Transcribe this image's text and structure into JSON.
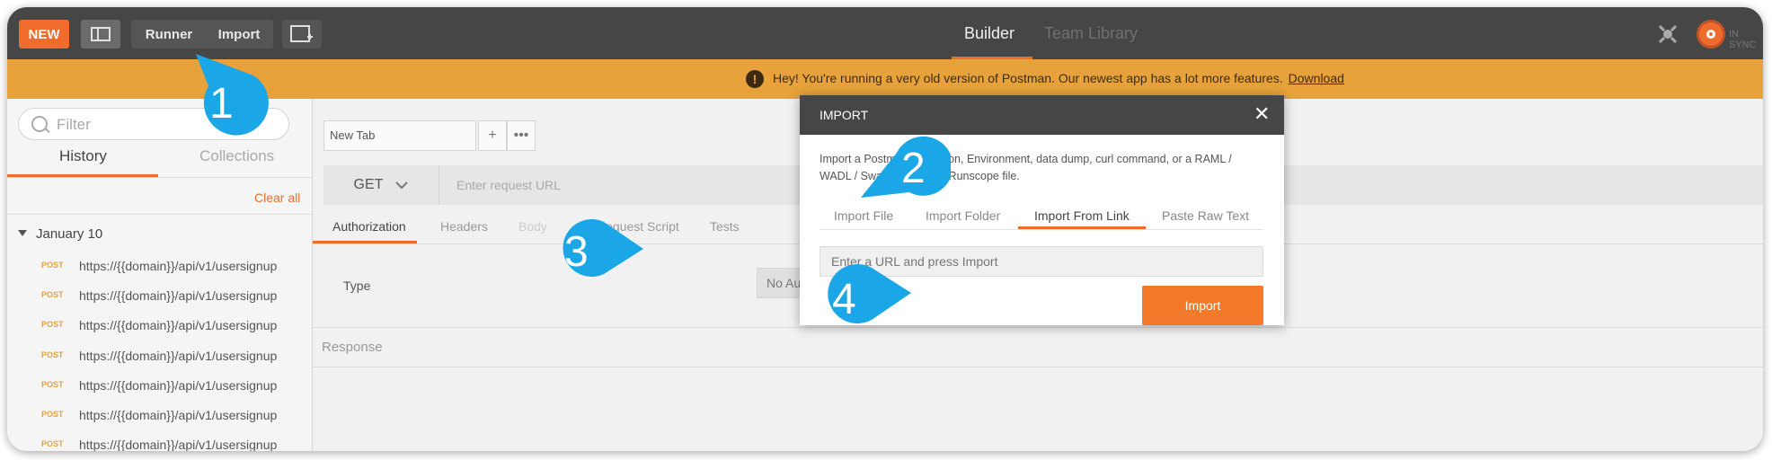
{
  "toolbar": {
    "new_label": "NEW",
    "runner_label": "Runner",
    "import_label": "Import",
    "builder_tab": "Builder",
    "team_library_tab": "Team Library",
    "sync_status": "IN SYNC"
  },
  "banner": {
    "message": "Hey! You're running a very old version of Postman. Our newest app has a lot more features.",
    "link": "Download"
  },
  "sidebar": {
    "filter_placeholder": "Filter",
    "tabs": [
      "History",
      "Collections"
    ],
    "clear_all": "Clear all",
    "group_label": "January 10",
    "history": [
      {
        "method": "POST",
        "url": "https://{{domain}}/api/v1/usersignup"
      },
      {
        "method": "POST",
        "url": "https://{{domain}}/api/v1/usersignup"
      },
      {
        "method": "POST",
        "url": "https://{{domain}}/api/v1/usersignup"
      },
      {
        "method": "POST",
        "url": "https://{{domain}}/api/v1/usersignup"
      },
      {
        "method": "POST",
        "url": "https://{{domain}}/api/v1/usersignup"
      },
      {
        "method": "POST",
        "url": "https://{{domain}}/api/v1/usersignup"
      },
      {
        "method": "POST",
        "url": "https://{{domain}}/api/v1/usersignup"
      }
    ]
  },
  "main": {
    "new_tab_label": "New Tab",
    "method": "GET",
    "url_placeholder": "Enter request URL",
    "request_tabs": [
      "Authorization",
      "Headers",
      "Body",
      "Pre-request Script",
      "Tests"
    ],
    "type_label": "Type",
    "auth_value": "No Auth",
    "response_label": "Response"
  },
  "modal": {
    "title": "IMPORT",
    "desc_line1": "Import a Postman Collection, Environment, data dump, curl command, or a RAML /",
    "desc_line2": "WADL / Swagger(v1/v2) / Runscope file.",
    "tabs": [
      "Import File",
      "Import Folder",
      "Import From Link",
      "Paste Raw Text"
    ],
    "url_placeholder": "Enter a URL and press Import",
    "import_button": "Import"
  },
  "callouts": [
    "1",
    "2",
    "3",
    "4"
  ],
  "colors": {
    "accent": "#ef6c2d",
    "callout": "#1ba6e8",
    "banner": "#e7a23b",
    "topbar": "#464646"
  }
}
